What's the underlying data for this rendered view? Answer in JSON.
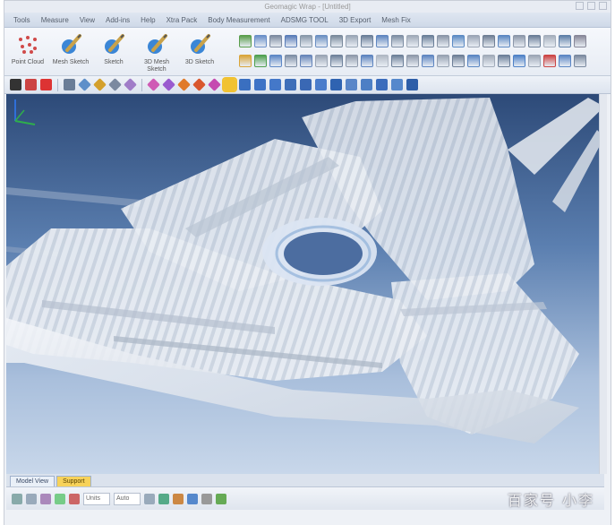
{
  "window": {
    "title": "Geomagic Wrap - [Untitled]"
  },
  "menubar": {
    "items": [
      {
        "label": "Tools"
      },
      {
        "label": "Measure"
      },
      {
        "label": "View"
      },
      {
        "label": "Add-ins"
      },
      {
        "label": "Help"
      },
      {
        "label": "Xtra Pack"
      },
      {
        "label": "Body Measurement"
      },
      {
        "label": "ADSMG TOOL"
      },
      {
        "label": "3D Export"
      },
      {
        "label": "Mesh Fix"
      }
    ]
  },
  "ribbon": {
    "big_tools": [
      {
        "name": "point-cloud-tool",
        "label": "Point Cloud",
        "icon": "dots-icon"
      },
      {
        "name": "mesh-sketch-tool",
        "label": "Mesh Sketch",
        "icon": "pencil-icon"
      },
      {
        "name": "sketch-tool",
        "label": "Sketch",
        "icon": "pencil-icon"
      },
      {
        "name": "3d-mesh-sketch-tool",
        "label": "3D Mesh\nSketch",
        "icon": "pencil-icon"
      },
      {
        "name": "3d-sketch-tool",
        "label": "3D Sketch",
        "icon": "pencil-icon"
      }
    ],
    "icon_rows": [
      [
        "#5a9e4c",
        "#6a8fc8",
        "#7c8aa0",
        "#5a7db8",
        "#8899aa",
        "#6b8fc2",
        "#7a8a9c",
        "#9aa6b6",
        "#6a7e98",
        "#5f86c0",
        "#7e8ea4",
        "#a0aab8",
        "#6b7f99",
        "#8a96a8",
        "#5c8bc4",
        "#9ba5b5",
        "#707f95",
        "#5c88c2",
        "#8d98aa",
        "#6a7d97",
        "#a4aebc",
        "#5e7fa8",
        "#889"
      ],
      [
        "#d9a53a",
        "#4fa04f",
        "#5c87c6",
        "#7f8fa6",
        "#6685b9",
        "#9aa5b4",
        "#6f829b",
        "#8f9aab",
        "#5d84bf",
        "#b0b8c4",
        "#6d8099",
        "#8e99aa",
        "#5f86c1",
        "#97a2b2",
        "#6e7f97",
        "#5a86c3",
        "#a1abb9",
        "#6c7f99",
        "#4f82c7",
        "#9ca6b5",
        "#cc4444",
        "#5b86c4",
        "#7b8aa0"
      ]
    ]
  },
  "viewbar": {
    "icons": [
      "#333",
      "#c44",
      "#d33",
      "#6a7d97",
      "#5e8fc9",
      "#d4a02c",
      "#7b89a0",
      "#a07cc8",
      "#cf5bb5",
      "#9a5bcf",
      "#e07a2a",
      "#d9572e",
      "#c54ab0",
      "#f1c232",
      "#3a6fc0",
      "#3e73c6",
      "#4478c9",
      "#3f6fb9",
      "#3a68b4",
      "#4a7ccb",
      "#2f63b1",
      "#5a86c8",
      "#4d7fc5",
      "#3b6cbc",
      "#5588cc",
      "#2d5ea8"
    ]
  },
  "viewport": {
    "label": "3D point cloud scan"
  },
  "tabs": [
    {
      "label": "Model View",
      "active": false
    },
    {
      "label": "Support",
      "active": true
    }
  ],
  "statusbar": {
    "icons": [
      "#8aa",
      "#9ab",
      "#a8b",
      "#7c8",
      "#c66",
      "#9ab",
      "#5a8",
      "#c84",
      "#58c",
      "#999",
      "#6a5"
    ],
    "fields": [
      "Units",
      "Auto"
    ]
  },
  "watermark": "百家号 小李"
}
